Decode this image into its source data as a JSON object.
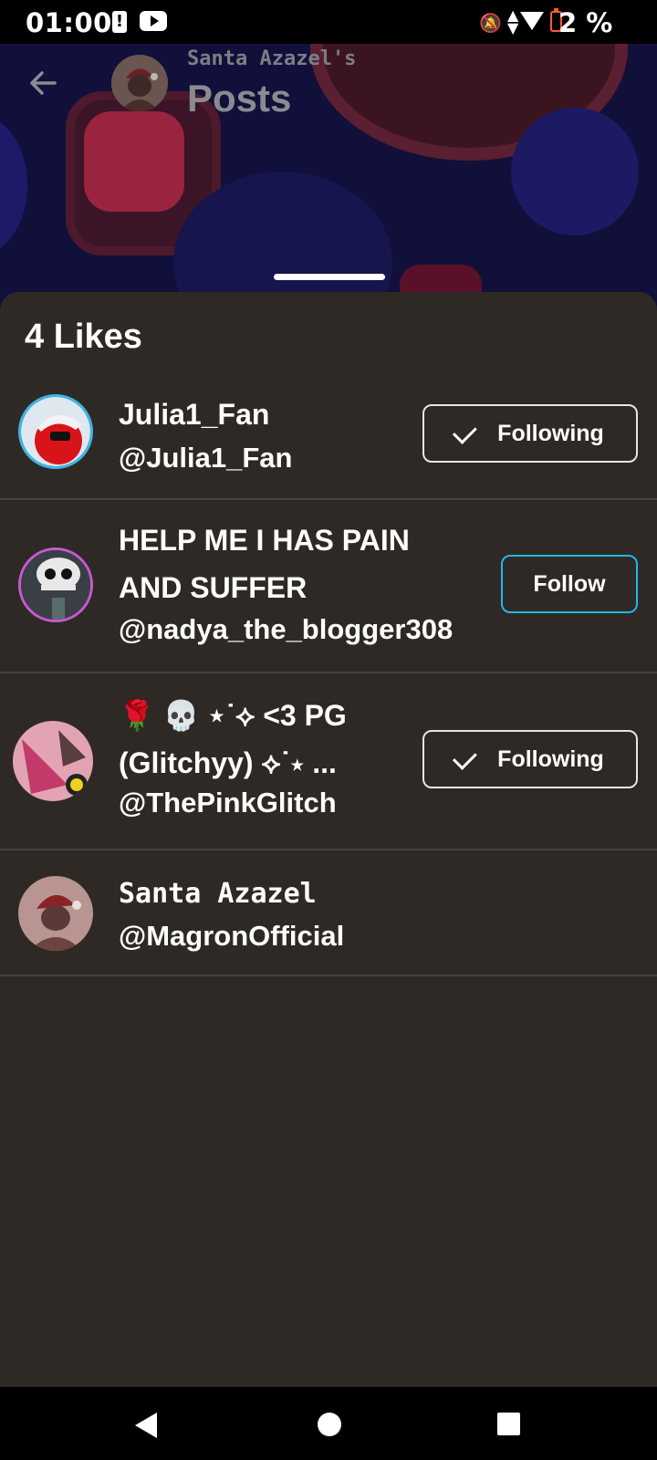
{
  "status_bar": {
    "time": "01:00",
    "alert_icon": "alert-icon",
    "battery_text": "2 %"
  },
  "header": {
    "subtitle": "Santa Azazel's",
    "title": "Posts",
    "back_icon": "back-arrow-icon"
  },
  "sheet": {
    "title": "4 Likes",
    "users": [
      {
        "name": "Julia1_Fan",
        "handle": "@Julia1_Fan",
        "button": "Following"
      },
      {
        "name_line1": "HELP ME I HAS PAIN",
        "name_line2": "AND SUFFER",
        "handle": "@nadya_the_blogger308",
        "button": "Follow"
      },
      {
        "name_line1": "🌹 💀 ⋆˙⟡ <3 PG",
        "name_line2": "(Glitchyy) ⟡˙⋆ ...",
        "handle": "@ThePinkGlitch",
        "button": "Following"
      },
      {
        "name": "Santa Azazel",
        "handle": "@MagronOfficial"
      }
    ]
  },
  "colors": {
    "sheet_bg": "#2e2925",
    "follow_accent": "#25b5ea",
    "header_bg": "#11103a"
  }
}
